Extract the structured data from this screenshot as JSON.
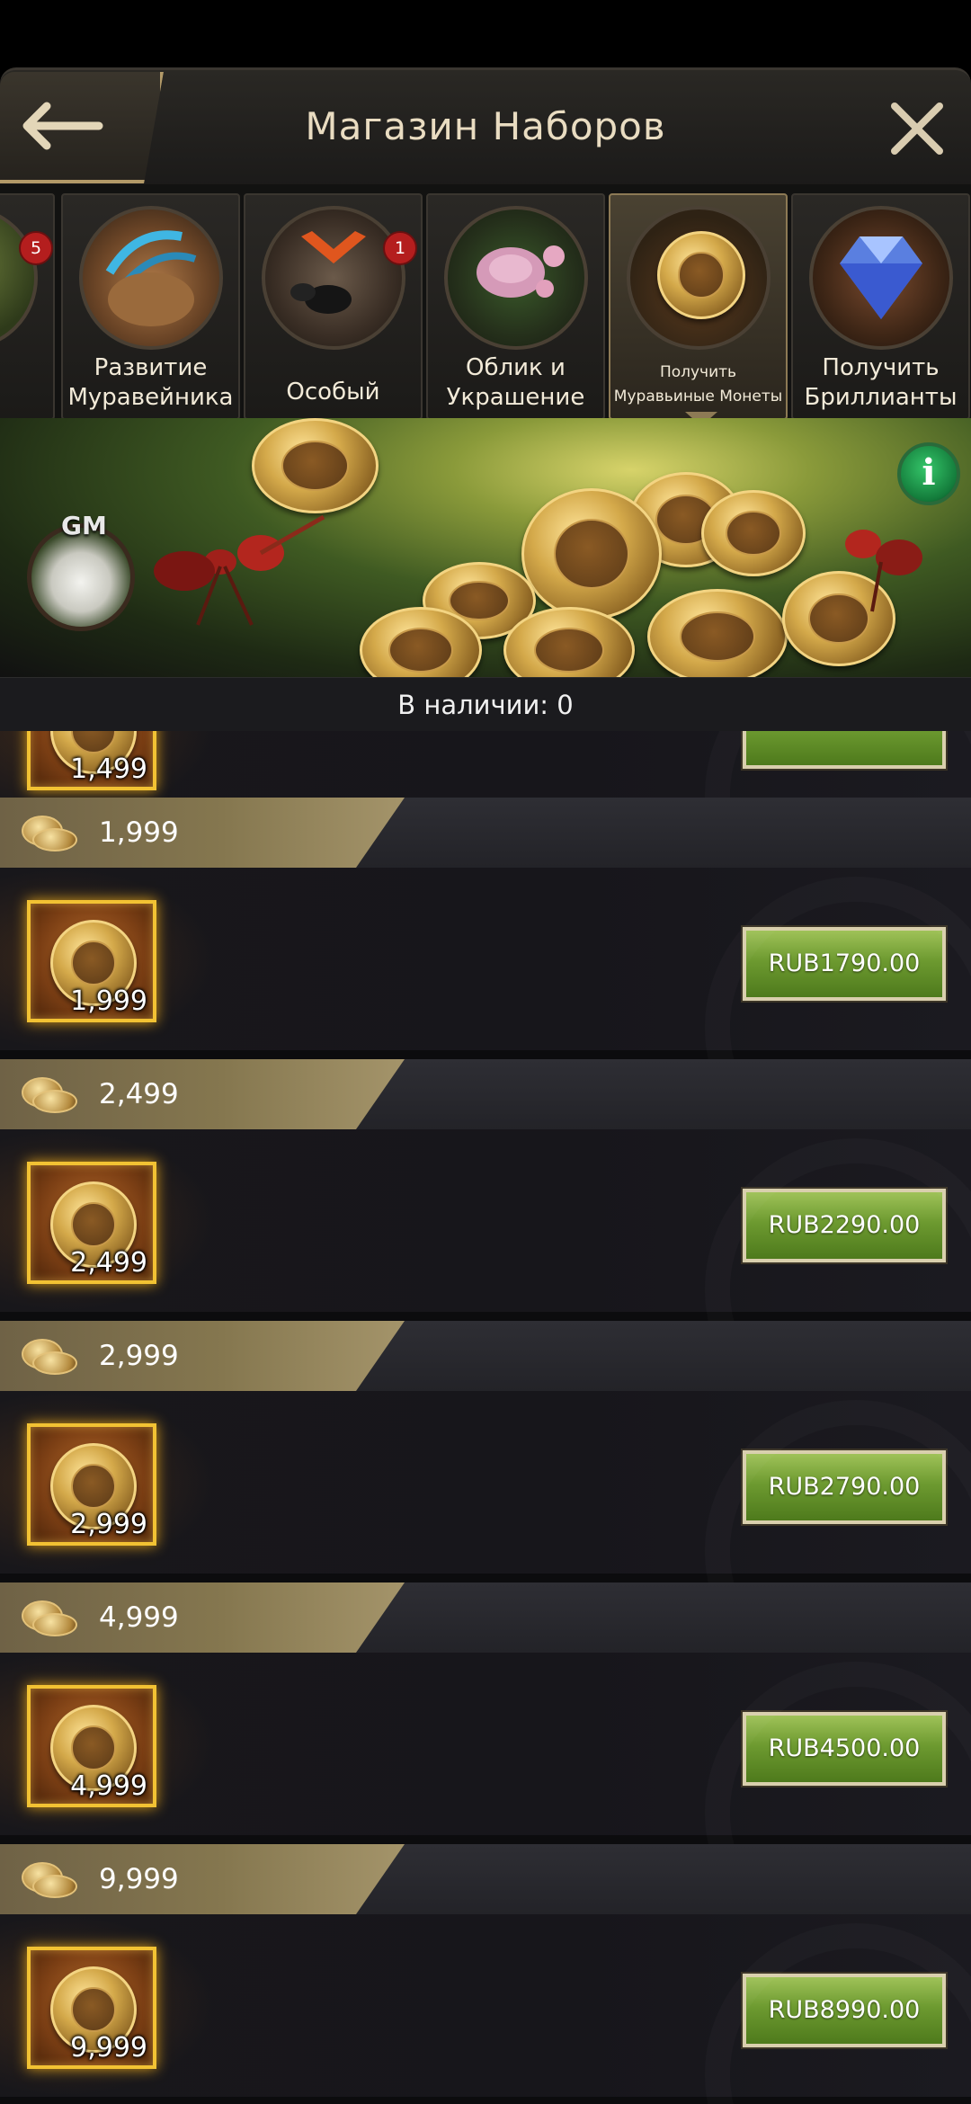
{
  "header": {
    "title": "Магазин Наборов"
  },
  "tabs": [
    {
      "label": "ва",
      "badge": "5"
    },
    {
      "label": "Развитие Муравейника"
    },
    {
      "label": "Особый",
      "badge": "1"
    },
    {
      "label": "Облик и Украшение"
    },
    {
      "label": "Получить Муравьиные Монеты",
      "active": true
    },
    {
      "label": "Получить Бриллианты"
    }
  ],
  "banner": {
    "gm_label": "GM",
    "info_label": "i"
  },
  "stock": {
    "text": "В наличии: 0"
  },
  "partial_item": {
    "qty": "1,499"
  },
  "packages": [
    {
      "amount": "1,999",
      "price": "RUB1790.00"
    },
    {
      "amount": "2,499",
      "price": "RUB2290.00"
    },
    {
      "amount": "2,999",
      "price": "RUB2790.00"
    },
    {
      "amount": "4,999",
      "price": "RUB4500.00"
    },
    {
      "amount": "9,999",
      "price": "RUB8990.00"
    }
  ],
  "colors": {
    "accent_gold": "#b39a68",
    "buy_green": "#6d9a30",
    "badge_red": "#b41e1e"
  }
}
